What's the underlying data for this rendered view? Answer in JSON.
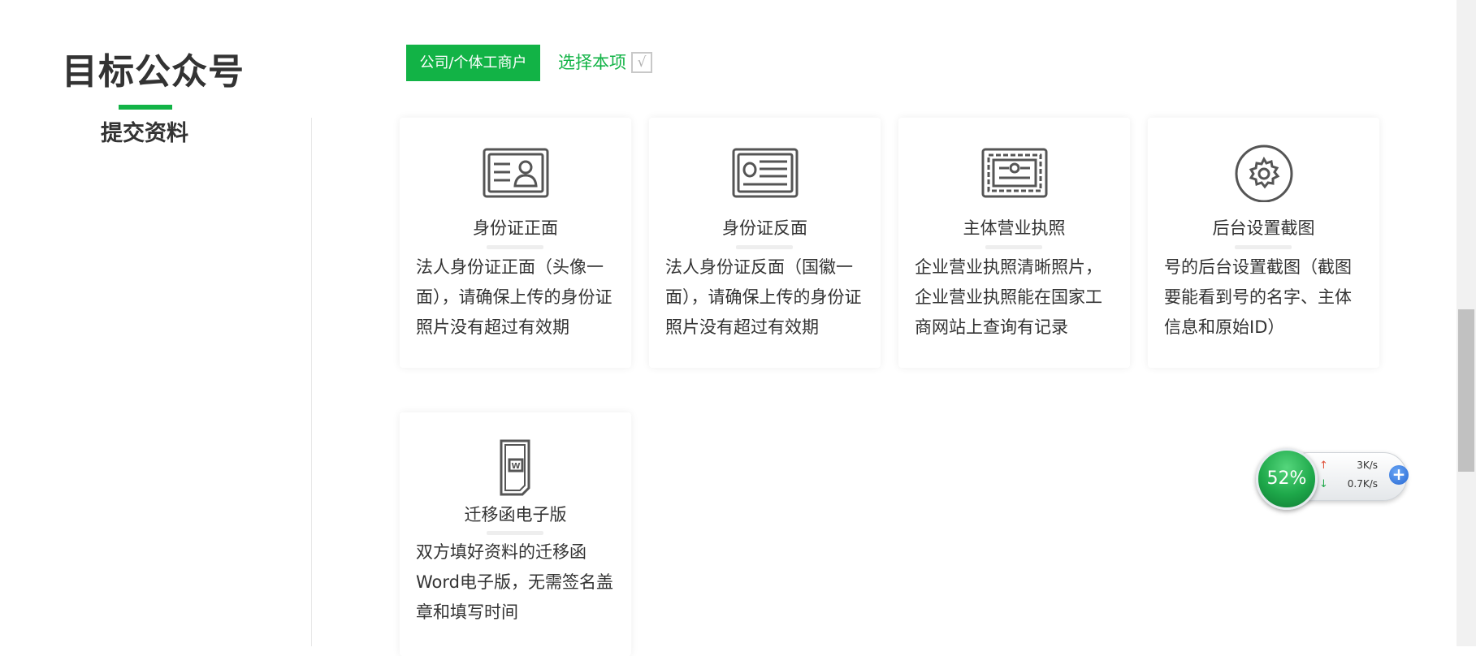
{
  "page": {
    "title": "目标公众号",
    "subtitle": "提交资料"
  },
  "type_selector": {
    "button_label": "公司/个体工商户",
    "select_label": "选择本项",
    "check_mark": "√"
  },
  "cards": [
    {
      "icon": "id-card-front-icon",
      "title": "身份证正面",
      "description": "法人身份证正面（头像一面），请确保上传的身份证照片没有超过有效期"
    },
    {
      "icon": "id-card-back-icon",
      "title": "身份证反面",
      "description": "法人身份证反面（国徽一面），请确保上传的身份证照片没有超过有效期"
    },
    {
      "icon": "business-license-icon",
      "title": "主体营业执照",
      "description": "企业营业执照清晰照片，企业营业执照能在国家工商网站上查询有记录"
    },
    {
      "icon": "gear-icon",
      "title": "后台设置截图",
      "description": "号的后台设置截图（截图要能看到号的名字、主体信息和原始ID）"
    },
    {
      "icon": "word-document-icon",
      "title": "迁移函电子版",
      "description": "双方填好资料的迁移函Word电子版，无需签名盖章和填写时间"
    }
  ],
  "speed_widget": {
    "percent": "52%",
    "upload": "3K/s",
    "download": "0.7K/s",
    "upload_arrow": "↑",
    "download_arrow": "↓",
    "plus": "+"
  },
  "colors": {
    "accent": "#12b346",
    "text": "#333333",
    "icon_stroke": "#555555"
  }
}
